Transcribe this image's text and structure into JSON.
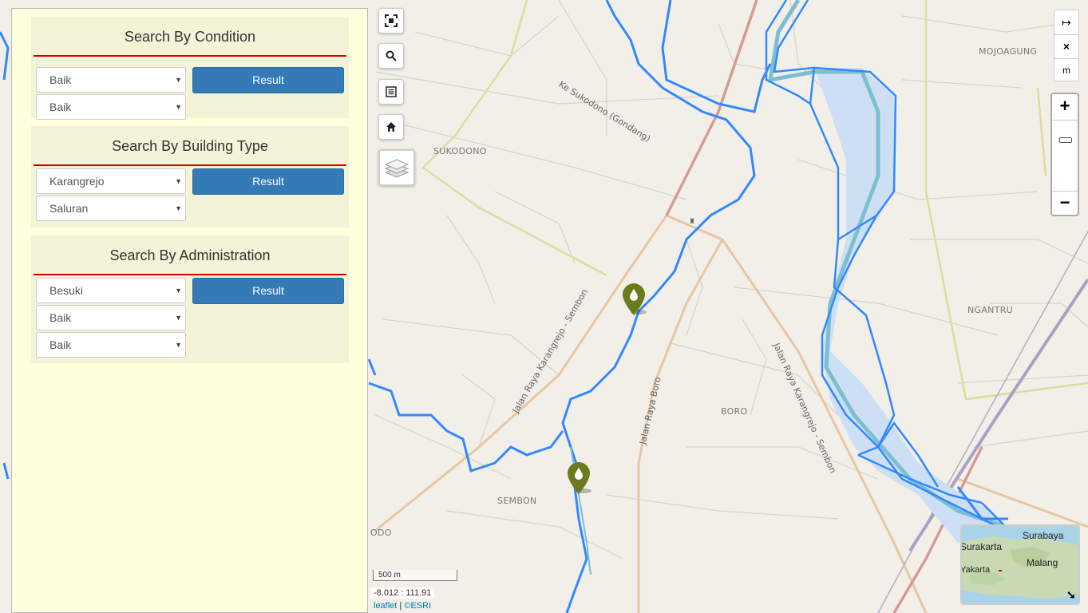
{
  "panel": {
    "condition": {
      "title": "Search By Condition",
      "select_1": "Baik",
      "select_2": "Baik",
      "button": "Result"
    },
    "building_type": {
      "title": "Search By Building Type",
      "select_1": "Karangrejo",
      "select_2": "Saluran",
      "button": "Result"
    },
    "administration": {
      "title": "Search By Administration",
      "select_1": "Besuki",
      "select_2": "Baik",
      "select_3": "Baik",
      "button": "Result"
    }
  },
  "map_controls": {
    "left_icons": [
      "fullscreen-icon",
      "search-icon",
      "list-icon",
      "home-icon",
      "layers-icon"
    ],
    "measure_labels": [
      "↦",
      "×",
      "m"
    ],
    "zoom_in": "+",
    "zoom_out": "−"
  },
  "map_labels": {
    "places": [
      "MOJOAGUNG",
      "SUKODONO",
      "NGANTRU",
      "BORO",
      "SEMBON",
      "ODO"
    ],
    "roads": [
      "Ke Sukodono (Gondang)",
      "Jalan Raya Karangrejo - Sembon",
      "Jalan Raya Boro",
      "Jalan Raya Karangrejo - Sembon"
    ]
  },
  "scale": "500 m",
  "coords": "-8.012 : 111.91",
  "attribution": {
    "leaflet": "leaflet",
    "sep": " | ",
    "esri": "©ESRI"
  },
  "minimap": {
    "labels": [
      "Surabaya",
      "Surakarta",
      "Malang",
      "Yakarta"
    ]
  },
  "colors": {
    "panel_bg": "#ffffdd",
    "section_bg": "#f3f3d8",
    "accent_red": "#d40000",
    "button_blue": "#337ab7",
    "river_blue": "#3388ff",
    "marker_olive": "#6b7a1f"
  }
}
